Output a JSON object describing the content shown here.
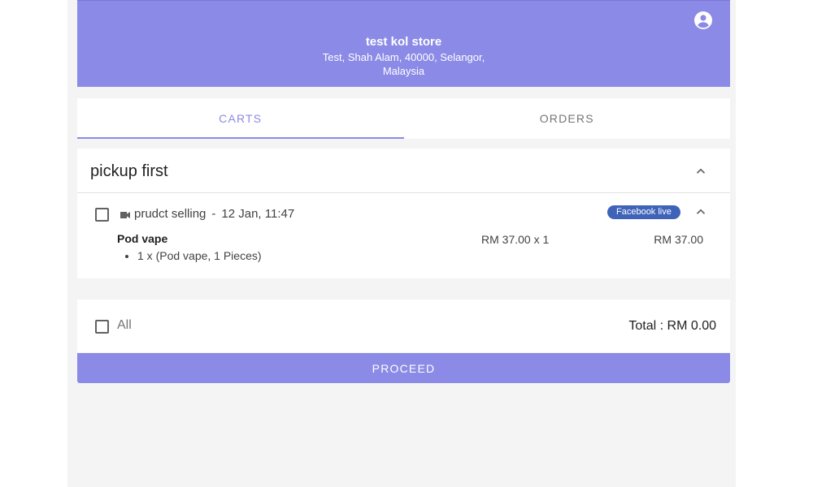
{
  "header": {
    "store_name": "test kol store",
    "address": "Test, Shah Alam, 40000, Selangor, Malaysia",
    "profile_icon": "account-circle-icon"
  },
  "tabs": [
    {
      "label": "CARTS",
      "active": true
    },
    {
      "label": "ORDERS",
      "active": false
    }
  ],
  "group": {
    "title": "pickup first",
    "order": {
      "channel_icon": "video-camera-icon",
      "title": "prudct selling",
      "separator": "-",
      "datetime": "12 Jan, 11:47",
      "badge": "Facebook live",
      "checked": false,
      "item": {
        "name": "Pod vape",
        "price": "RM 37.00 x 1",
        "total": "RM 37.00",
        "detail": "1 x (Pod vape, 1 Pieces)"
      }
    }
  },
  "footer": {
    "all_label": "All",
    "total": "Total : RM 0.00",
    "proceed_label": "PROCEED"
  },
  "colors": {
    "primary": "#8b8ae6",
    "badge": "#3f63b9",
    "background": "#f4f4f4"
  }
}
